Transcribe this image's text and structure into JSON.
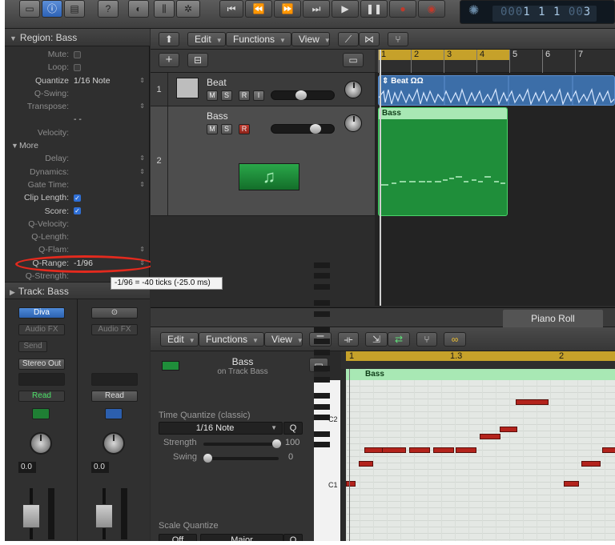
{
  "lcd": {
    "pos_dim": "000",
    "pos_bar": "1",
    "pos_beat": "1",
    "pos_div": "1",
    "pos_dim2": "00",
    "pos_tick": "3"
  },
  "inspector": {
    "region_header": "Region: Bass",
    "params": [
      {
        "label": "Mute:",
        "type": "check",
        "on": false
      },
      {
        "label": "Loop:",
        "type": "check",
        "on": false
      },
      {
        "label": "Quantize",
        "value": "1/16 Note",
        "lit": true,
        "stepper": true
      },
      {
        "label": "Q-Swing:",
        "value": ""
      },
      {
        "label": "Transpose:",
        "value": "",
        "stepper": true
      },
      {
        "label": "",
        "value": "- -"
      },
      {
        "label": "Velocity:",
        "value": ""
      },
      {
        "label": "More",
        "type": "section"
      },
      {
        "label": "Delay:",
        "value": "",
        "stepper": true
      },
      {
        "label": "Dynamics:",
        "value": "",
        "stepper": true
      },
      {
        "label": "Gate Time:",
        "value": "",
        "stepper": true
      },
      {
        "label": "Clip Length:",
        "type": "check",
        "on": true,
        "lit": true
      },
      {
        "label": "Score:",
        "type": "check",
        "on": true,
        "lit": true
      },
      {
        "label": "Q-Velocity:",
        "value": ""
      },
      {
        "label": "Q-Length:",
        "value": ""
      },
      {
        "label": "Q-Flam:",
        "value": "",
        "stepper": true
      },
      {
        "label": "Q-Range:",
        "value": "-1/96",
        "lit": true,
        "stepper": true
      },
      {
        "label": "Q-Strength:",
        "value": ""
      }
    ],
    "track_header": "Track:  Bass",
    "tooltip": "-1/96 = -40 ticks (-25.0 ms)"
  },
  "strips": [
    {
      "plugin": "Diva",
      "audio_fx": "Audio FX",
      "send": "Send",
      "output": "Stereo Out",
      "group": "",
      "automation": "Read",
      "volume": "0.0"
    },
    {
      "plugin": "",
      "audio_fx": "Audio FX",
      "send": "",
      "output": "",
      "group": "",
      "automation": "Read",
      "volume": "0.0"
    }
  ],
  "tracks_toolbar": {
    "edit": "Edit",
    "functions": "Functions",
    "view": "View"
  },
  "ruler_ticks": [
    "1",
    "2",
    "3",
    "4",
    "5",
    "6",
    "7"
  ],
  "tracks": [
    {
      "num": "1",
      "name": "Beat",
      "m": "M",
      "s": "S",
      "r": "R",
      "i": "I"
    },
    {
      "num": "2",
      "name": "Bass",
      "m": "M",
      "s": "S",
      "r": "R"
    }
  ],
  "regions": {
    "beat": "Beat",
    "beat_badge": "ΩΩ",
    "bass": "Bass"
  },
  "piano_roll": {
    "tab": "Piano Roll",
    "edit": "Edit",
    "functions": "Functions",
    "view": "View",
    "region_name": "Bass",
    "region_sub": "on Track Bass",
    "time_quantize_label": "Time Quantize (classic)",
    "quantize_value": "1/16 Note",
    "q_button": "Q",
    "strength_label": "Strength",
    "strength_value": "100",
    "swing_label": "Swing",
    "swing_value": "0",
    "scale_quantize_label": "Scale Quantize",
    "scale_off": "Off",
    "scale_major": "Major",
    "ruler": [
      "1",
      "1.3",
      "2"
    ],
    "region_label": "Bass",
    "key_c2": "C2",
    "key_c1": "C1",
    "notes": [
      {
        "start": 0.0,
        "len": 0.09,
        "pitch": 0
      },
      {
        "start": 0.12,
        "len": 0.13,
        "pitch": 3
      },
      {
        "start": 0.17,
        "len": 0.22,
        "pitch": 5
      },
      {
        "start": 0.33,
        "len": 0.22,
        "pitch": 5
      },
      {
        "start": 0.58,
        "len": 0.19,
        "pitch": 5
      },
      {
        "start": 0.8,
        "len": 0.19,
        "pitch": 5
      },
      {
        "start": 1.01,
        "len": 0.19,
        "pitch": 5
      },
      {
        "start": 1.23,
        "len": 0.19,
        "pitch": 7
      },
      {
        "start": 1.41,
        "len": 0.16,
        "pitch": 8
      },
      {
        "start": 1.56,
        "len": 0.3,
        "pitch": 12
      },
      {
        "start": 2.0,
        "len": 0.14,
        "pitch": 0
      },
      {
        "start": 2.16,
        "len": 0.18,
        "pitch": 3
      },
      {
        "start": 2.35,
        "len": 0.2,
        "pitch": 5
      }
    ]
  }
}
